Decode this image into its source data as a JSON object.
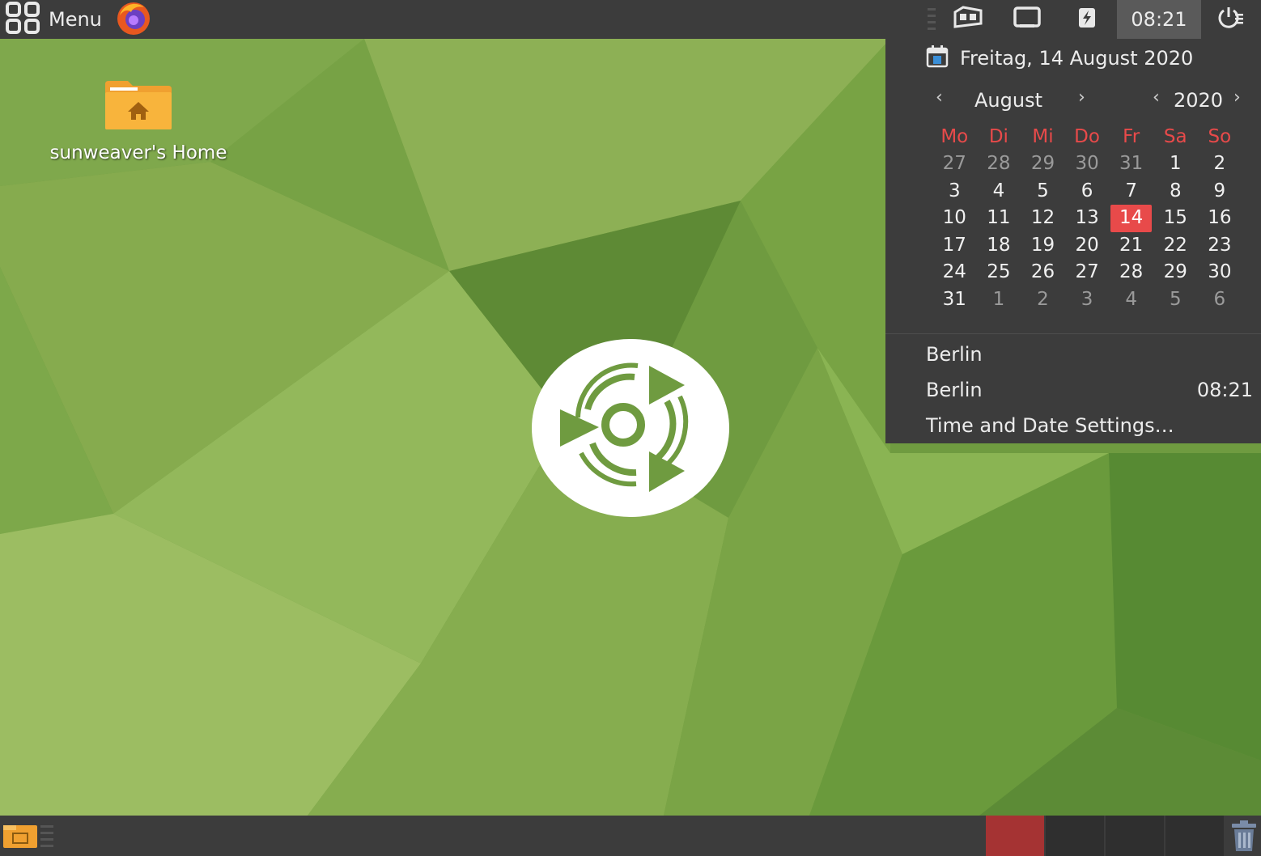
{
  "top_panel": {
    "menu_label": "Menu",
    "clock": "08:21"
  },
  "desktop": {
    "home_icon_label": "sunweaver's Home"
  },
  "calendar": {
    "date_header": "Freitag, 14 August 2020",
    "month": "August",
    "year": "2020",
    "weekdays": [
      "Mo",
      "Di",
      "Mi",
      "Do",
      "Fr",
      "Sa",
      "So"
    ],
    "weeks": [
      [
        "27",
        "28",
        "29",
        "30",
        "31",
        "1",
        "2"
      ],
      [
        "3",
        "4",
        "5",
        "6",
        "7",
        "8",
        "9"
      ],
      [
        "10",
        "11",
        "12",
        "13",
        "14",
        "15",
        "16"
      ],
      [
        "17",
        "18",
        "19",
        "20",
        "21",
        "22",
        "23"
      ],
      [
        "24",
        "25",
        "26",
        "27",
        "28",
        "29",
        "30"
      ],
      [
        "31",
        "1",
        "2",
        "3",
        "4",
        "5",
        "6"
      ]
    ],
    "today": "14",
    "locations": [
      {
        "name": "Berlin",
        "time": ""
      },
      {
        "name": "Berlin",
        "time": "08:21"
      }
    ],
    "settings_label": "Time and Date Settings…"
  },
  "colors": {
    "panel": "#3c3c3c",
    "accent_red": "#e84a4a",
    "workspace_active": "#a53333"
  }
}
